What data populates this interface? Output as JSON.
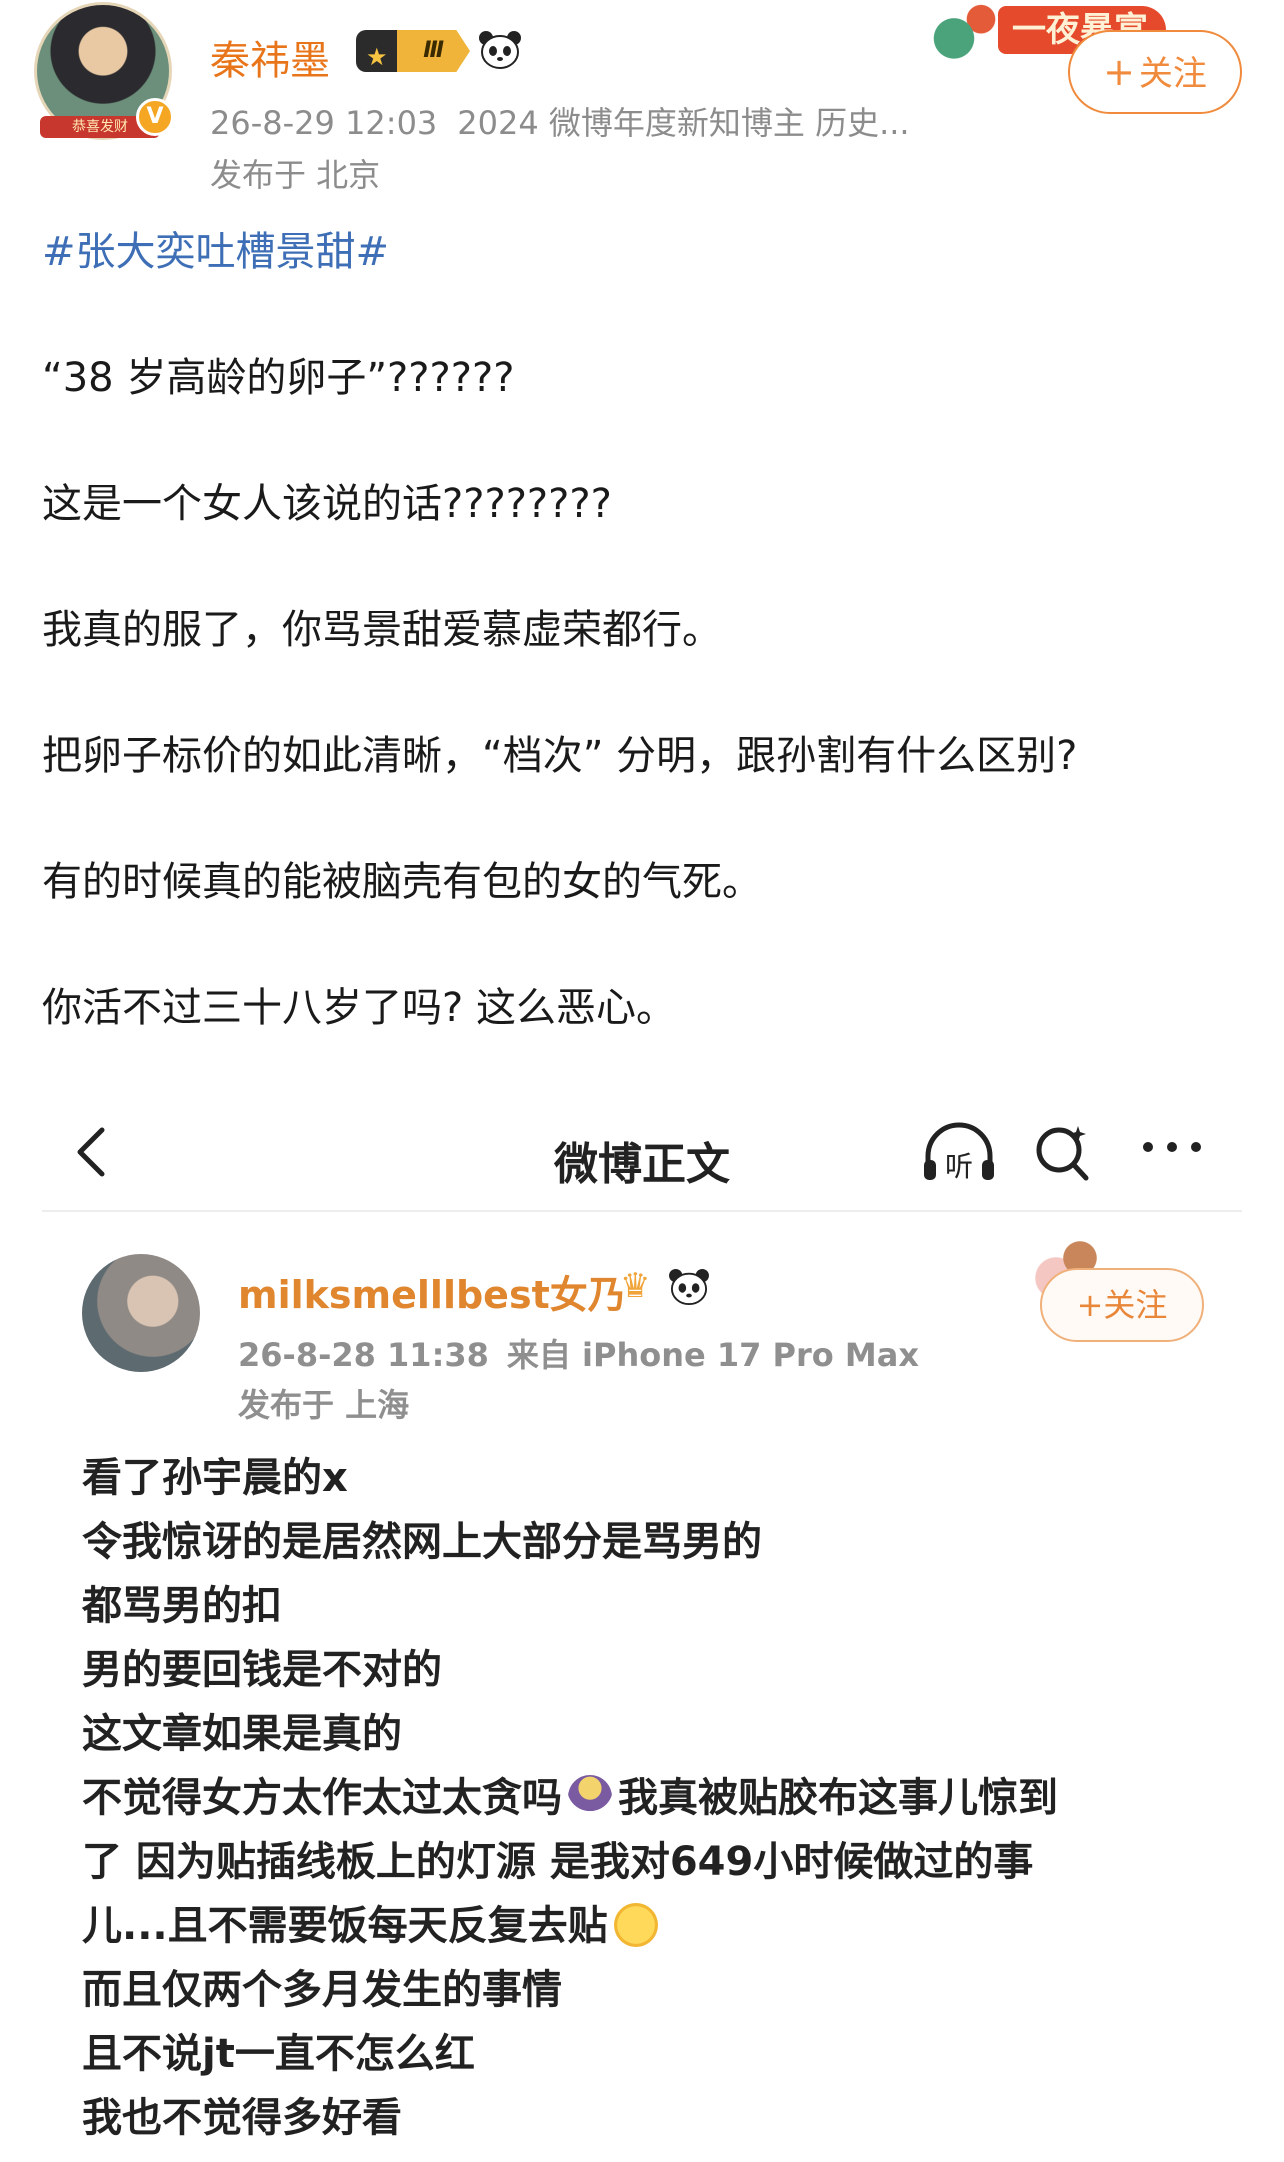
{
  "author": {
    "name": "秦祎墨",
    "avatar_band_text": "恭喜发财",
    "verified_mark": "V",
    "vip_level": "Ⅲ",
    "timestamp": "26-8-29 12:03",
    "title_tag": "2024 微博年度新知博主 历史...",
    "location": "发布于 北京",
    "follow_label": "关注",
    "follow_plus": "+"
  },
  "banner": {
    "text": "一夜暴富"
  },
  "post": {
    "hashtag": "#张大奕吐槽景甜#",
    "paragraphs": [
      "“38 岁高龄的卵子”??????",
      "这是一个女人该说的话????????",
      "我真的服了，你骂景甜爱慕虚荣都行。",
      "把卵子标价的如此清晰，“档次” 分明，跟孙割有什么区别?",
      "有的时候真的能被脑壳有包的女的气死。",
      "你活不过三十八岁了吗? 这么恶心。"
    ]
  },
  "embedded": {
    "nav_title": "微博正文",
    "listen_label": "听",
    "author_name": "milksmelllbest女乃",
    "crown_glyph": "♛",
    "timestamp": "26-8-28 11:38",
    "source": "来自 iPhone 17 Pro Max",
    "location": "发布于 上海",
    "follow_label": "关注",
    "follow_plus": "+",
    "lines": [
      "看了孙宇晨的x",
      "令我惊讶的是居然网上大部分是骂男的",
      "都骂男的扣",
      "男的要回钱是不对的",
      "这文章如果是真的",
      "不觉得女方太作太过太贪吗",
      "我真被贴胶布这事儿惊到",
      "了 因为贴插线板上的灯源 是我对649小时候做过的事",
      "儿...且不需要饭每天反复去贴",
      "而且仅两个多月发生的事情",
      "且不说jt一直不怎么红",
      "我也不觉得多好看"
    ]
  },
  "colors": {
    "username": "#e8751a",
    "hashtag": "#3e6fb6",
    "meta": "#8c8c8c",
    "follow": "#f08a3c",
    "embed_username": "#e0862e"
  }
}
